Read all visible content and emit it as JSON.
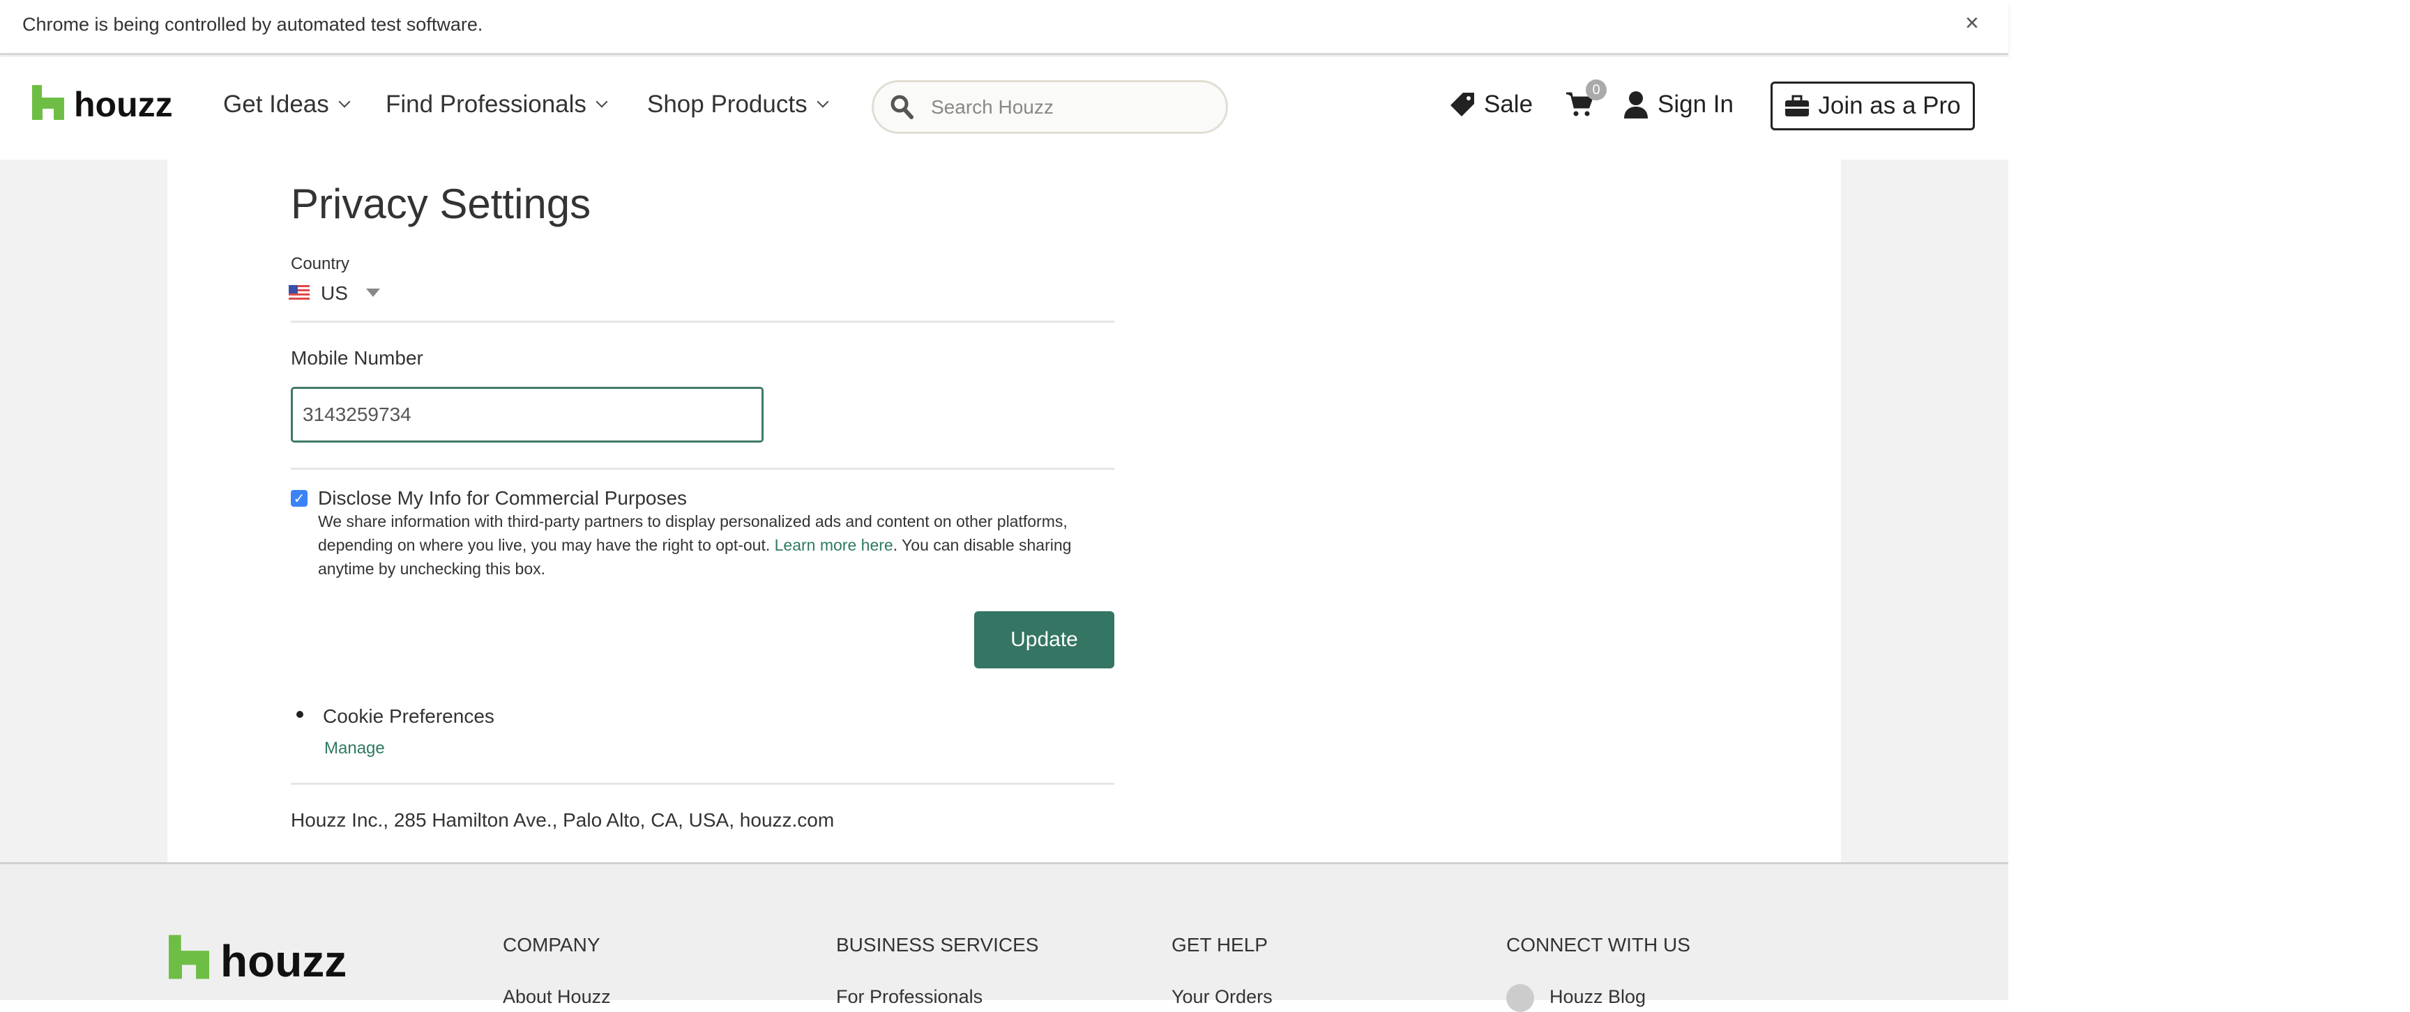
{
  "chrome_bar": {
    "message": "Chrome is being controlled by automated test software.",
    "close_label": "×"
  },
  "header": {
    "logo": "houzz",
    "nav": [
      {
        "label": "Get Ideas"
      },
      {
        "label": "Find Professionals"
      },
      {
        "label": "Shop Products"
      }
    ],
    "search_placeholder": "Search Houzz",
    "sale_label": "Sale",
    "cart_count": "0",
    "sign_in_label": "Sign In",
    "join_label": "Join as a Pro",
    "brand_color": "#6ebe45"
  },
  "main": {
    "title": "Privacy Settings",
    "country_label": "Country",
    "country_value": "US",
    "mobile_label": "Mobile Number",
    "mobile_value": "3143259734",
    "disclose_label": "Disclose My Info for Commercial Purposes",
    "disclose_checked": true,
    "desc_before": "We share information with third-party partners to display personalized ads and content on other platforms, depending on where you live, you may have the right to opt-out. ",
    "desc_link": "Learn more here",
    "desc_after": ". You can disable sharing anytime by unchecking this box.",
    "update_label": "Update",
    "cookie_label": "Cookie Preferences",
    "manage_label": "Manage",
    "address": "Houzz Inc., 285 Hamilton Ave., Palo Alto, CA, USA, houzz.com",
    "accent_color": "#347563"
  },
  "footer": {
    "logo": "houzz",
    "columns": [
      {
        "heading": "COMPANY",
        "first_link": "About Houzz"
      },
      {
        "heading": "BUSINESS SERVICES",
        "first_link": "For Professionals"
      },
      {
        "heading": "GET HELP",
        "first_link": "Your Orders"
      },
      {
        "heading": "CONNECT WITH US",
        "first_link": "Houzz Blog"
      }
    ]
  }
}
